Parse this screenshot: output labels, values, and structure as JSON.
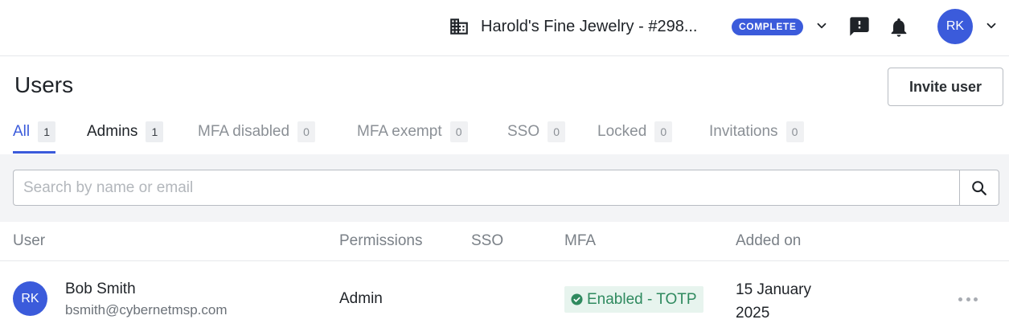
{
  "header": {
    "org_name": "Harold's Fine Jewelry - #298...",
    "org_icon": "building-icon",
    "status_badge": "COMPLETE",
    "icons": [
      "chevron-down-icon",
      "feedback-alert-icon",
      "bell-icon",
      "chevron-down-icon"
    ],
    "user_initials": "RK",
    "accent_color": "#3b5bdb"
  },
  "page": {
    "title": "Users",
    "invite_button": "Invite user"
  },
  "tabs": [
    {
      "label": "All",
      "count": "1",
      "active": true
    },
    {
      "label": "Admins",
      "count": "1"
    },
    {
      "label": "MFA disabled",
      "count": "0"
    },
    {
      "label": "MFA exempt",
      "count": "0"
    },
    {
      "label": "SSO",
      "count": "0"
    },
    {
      "label": "Locked",
      "count": "0"
    },
    {
      "label": "Invitations",
      "count": "0"
    }
  ],
  "search": {
    "value": "",
    "placeholder": "Search by name or email",
    "icon": "search-icon"
  },
  "table": {
    "columns": [
      "User",
      "Permissions",
      "SSO",
      "MFA",
      "Added on"
    ],
    "rows": [
      {
        "initials": "RK",
        "name": "Bob Smith",
        "email": "bsmith@cybernetmsp.com",
        "permissions": "Admin",
        "sso": "",
        "mfa": "Enabled - TOTP",
        "mfa_icon": "check-circle-icon",
        "added_line1": "15 January",
        "added_line2": "2025",
        "actions_icon": "more-horizontal-icon"
      }
    ]
  }
}
